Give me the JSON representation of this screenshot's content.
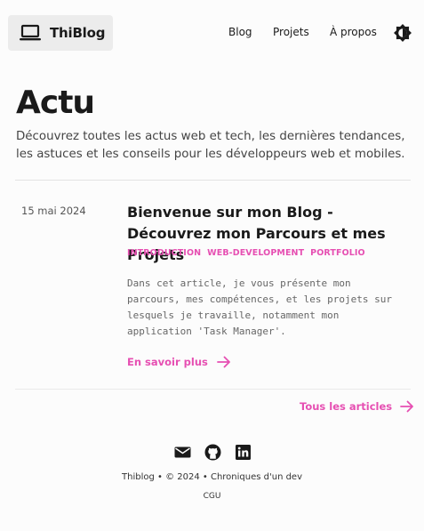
{
  "header": {
    "logo_text": "ThiBlog",
    "nav": [
      {
        "label": "Blog"
      },
      {
        "label": "Projets"
      },
      {
        "label": "À propos"
      }
    ]
  },
  "hero": {
    "title": "Actu",
    "description": "Découvrez toutes les actus web et tech, les dernières tendances, les astuces et les conseils pour les développeurs web et mobiles."
  },
  "posts": [
    {
      "date": "15 mai 2024",
      "title": "Bienvenue sur mon Blog - Découvrez mon Parcours et mes Projets",
      "tags": [
        "INTRODUCTION",
        "WEB-DEVELOPMENT",
        "PORTFOLIO"
      ],
      "excerpt": "Dans cet article, je vous présente mon parcours, mes compétences, et les projets sur lesquels je travaille, notamment mon application 'Task Manager'.",
      "read_more": "En savoir plus"
    }
  ],
  "all_posts_label": "Tous les articles",
  "footer": {
    "social_icons": [
      "mail-icon",
      "github-icon",
      "linkedin-icon"
    ],
    "copyright": "Thiblog • © 2024 • Chroniques d'un dev",
    "cgu": "CGU"
  },
  "colors": {
    "accent": "#e64fb2",
    "text": "#1a1a1a",
    "muted": "#666666",
    "background": "#fcfcfc",
    "logo_bg": "#ececec"
  }
}
